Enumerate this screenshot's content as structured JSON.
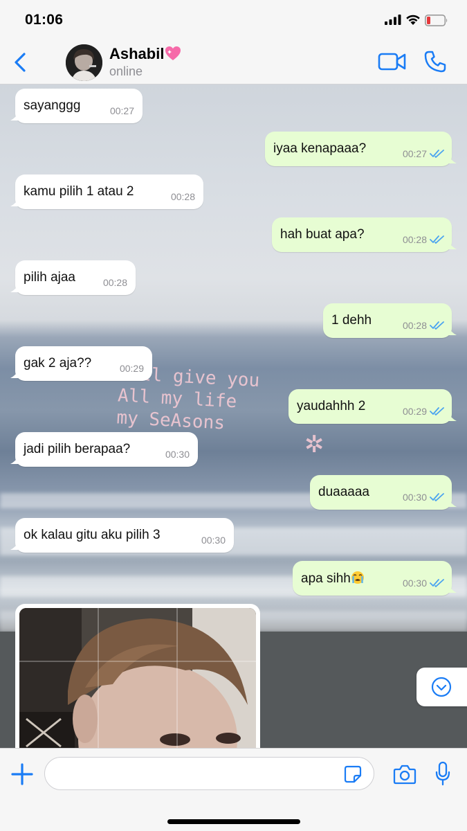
{
  "status_bar": {
    "time": "01:06"
  },
  "header": {
    "contact_name": "Ashabil",
    "contact_status": "online"
  },
  "overlay_caption": [
    "I'll give you",
    "All my life",
    "my SeAsons"
  ],
  "messages": [
    {
      "dir": "in",
      "text": "sayanggg",
      "time": "00:27"
    },
    {
      "dir": "out",
      "text": "iyaa kenapaaa?",
      "time": "00:27"
    },
    {
      "dir": "in",
      "text": "kamu pilih 1 atau 2",
      "time": "00:28"
    },
    {
      "dir": "out",
      "text": "hah buat apa?",
      "time": "00:28"
    },
    {
      "dir": "in",
      "text": "pilih ajaa",
      "time": "00:28"
    },
    {
      "dir": "out",
      "text": "1 dehh",
      "time": "00:28"
    },
    {
      "dir": "in",
      "text": "gak 2 aja??",
      "time": "00:29"
    },
    {
      "dir": "out",
      "text": "yaudahhh 2",
      "time": "00:29"
    },
    {
      "dir": "in",
      "text": "jadi pilih berapaa?",
      "time": "00:30"
    },
    {
      "dir": "out",
      "text": "duaaaaa",
      "time": "00:30"
    },
    {
      "dir": "in",
      "text": "ok kalau gitu aku pilih 3",
      "time": "00:30"
    },
    {
      "dir": "out",
      "text": "apa sihh",
      "time": "00:30",
      "emoji": "loudly-crying-face"
    }
  ],
  "icons": {
    "back": "chevron-left-icon",
    "video": "video-camera-icon",
    "call": "phone-icon",
    "attach": "plus-icon",
    "sticker": "sticker-icon",
    "camera": "camera-icon",
    "mic": "microphone-icon",
    "scroll": "chevron-down-circle-icon"
  },
  "colors": {
    "accent": "#1a7cf5",
    "outgoing_bubble": "#e7fdd3",
    "incoming_bubble": "#ffffff",
    "read_ticks": "#4aa3f0"
  }
}
